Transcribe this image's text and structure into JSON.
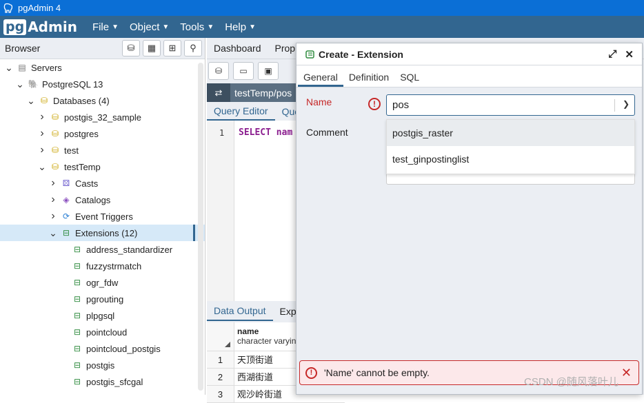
{
  "window": {
    "title": "pgAdmin 4"
  },
  "menubar": {
    "logo_pg": "pg",
    "logo_admin": "Admin",
    "menus": [
      "File",
      "Object",
      "Tools",
      "Help"
    ]
  },
  "browser": {
    "title": "Browser",
    "tree": [
      {
        "label": "Servers",
        "level": 0
      },
      {
        "label": "PostgreSQL 13",
        "level": 1
      },
      {
        "label": "Databases (4)",
        "level": 2
      },
      {
        "label": "postgis_32_sample",
        "level": 3
      },
      {
        "label": "postgres",
        "level": 3
      },
      {
        "label": "test",
        "level": 3
      },
      {
        "label": "testTemp",
        "level": 3
      },
      {
        "label": "Casts",
        "level": 4
      },
      {
        "label": "Catalogs",
        "level": 4
      },
      {
        "label": "Event Triggers",
        "level": 4
      },
      {
        "label": "Extensions (12)",
        "level": 4
      },
      {
        "label": "address_standardizer",
        "level": 5
      },
      {
        "label": "fuzzystrmatch",
        "level": 5
      },
      {
        "label": "ogr_fdw",
        "level": 5
      },
      {
        "label": "pgrouting",
        "level": 5
      },
      {
        "label": "plpgsql",
        "level": 5
      },
      {
        "label": "pointcloud",
        "level": 5
      },
      {
        "label": "pointcloud_postgis",
        "level": 5
      },
      {
        "label": "postgis",
        "level": 5
      },
      {
        "label": "postgis_sfcgal",
        "level": 5
      }
    ]
  },
  "main": {
    "tabs": [
      "Dashboard",
      "Prop"
    ],
    "connection": "testTemp/pos",
    "editor_tabs": [
      "Query Editor",
      "Que"
    ],
    "line_number": "1",
    "code": "SELECT nam",
    "output_tabs": [
      "Data Output",
      "Expl"
    ],
    "grid": {
      "column_name": "name",
      "column_type": "character varyin",
      "rows": [
        {
          "n": "1",
          "v": "天顶街道"
        },
        {
          "n": "2",
          "v": "西湖街道"
        },
        {
          "n": "3",
          "v": "观沙岭街道"
        }
      ]
    }
  },
  "dialog": {
    "title": "Create - Extension",
    "tabs": [
      "General",
      "Definition",
      "SQL"
    ],
    "name_label": "Name",
    "name_value": "pos",
    "comment_label": "Comment",
    "options": [
      "postgis_raster",
      "test_ginpostinglist"
    ],
    "error": "'Name' cannot be empty."
  },
  "watermark": "CSDN @随风落叶儿",
  "colors": {
    "brand": "#326690",
    "title_bar": "#0b6fd6",
    "error": "#c62828"
  }
}
